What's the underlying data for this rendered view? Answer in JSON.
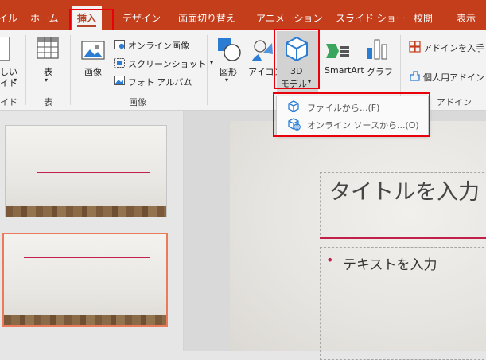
{
  "tabs": [
    {
      "label": "イル"
    },
    {
      "label": "ホーム"
    },
    {
      "label": "挿入"
    },
    {
      "label": "デザイン"
    },
    {
      "label": "画面切り替え"
    },
    {
      "label": "アニメーション"
    },
    {
      "label": "スライド ショー"
    },
    {
      "label": "校閲"
    },
    {
      "label": "表示"
    }
  ],
  "ribbon": {
    "newslide_line1": "しい",
    "newslide_line2": "イド",
    "newslide_arrow": "▾",
    "group_slide": "イド",
    "table_label": "表",
    "table_arrow": "▾",
    "group_table": "表",
    "image_label": "画像",
    "online_image": "オンライン画像",
    "screenshot": "スクリーンショット",
    "screenshot_arrow": "▾",
    "photo_album": "フォト アルバム",
    "photo_album_arrow": "▾",
    "group_images": "画像",
    "shapes_label": "図形",
    "shapes_arrow": "▾",
    "icons_label": "アイコン",
    "model3d_line1": "3D",
    "model3d_line2": "モデル",
    "model3d_arrow": "▾",
    "smartart_label": "SmartArt",
    "chart_label": "グラフ",
    "get_addins": "アドインを入手",
    "my_addins": "個人用アドイン",
    "group_addins": "アドイン"
  },
  "dropdown": {
    "from_file": "ファイルから...(F)",
    "online_sources": "オンライン ソースから...(O)"
  },
  "slide": {
    "title_placeholder": "タイトルを入力",
    "body_placeholder": "テキストを入力",
    "bullet": "•"
  },
  "colors": {
    "accent": "#c43e1c",
    "highlight_box": "#e8000b",
    "selected_thumb_border": "#e97a5a",
    "title_underline": "#c0204a"
  }
}
